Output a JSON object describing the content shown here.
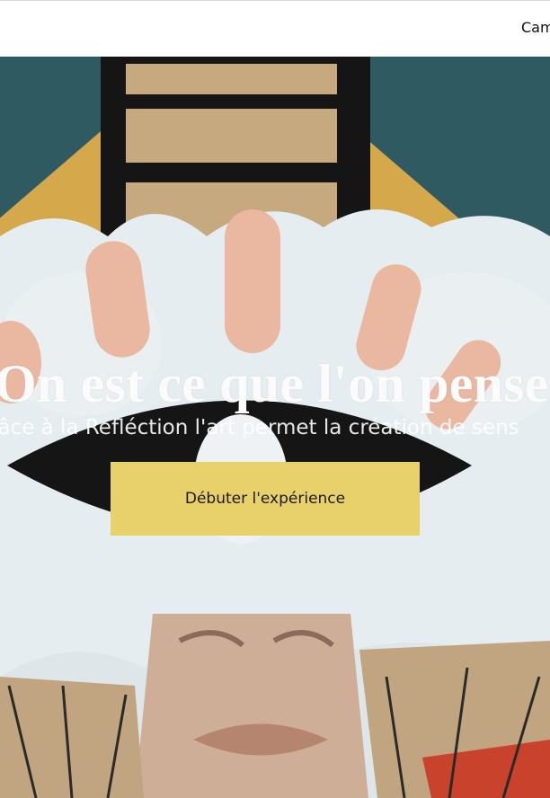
{
  "header": {
    "nav_label": "Cam"
  },
  "hero": {
    "title": "On est ce que l'on pense",
    "subtitle": "râce à la Refléction l'art permet la création de sens",
    "cta_label": "Débuter l'expérience"
  },
  "colors": {
    "header_bg": "#ffffff",
    "cta_bg": "#e8d06a",
    "headline_color": "#fbfbfb",
    "teal": "#2f5a61",
    "ochre": "#d5a84c",
    "cloud": "#e6edf0",
    "eye_black": "#151515",
    "finger_pink": "#eab7a1",
    "skin": "#cfae98",
    "green": "#2e8a5d",
    "red": "#c9422c"
  }
}
